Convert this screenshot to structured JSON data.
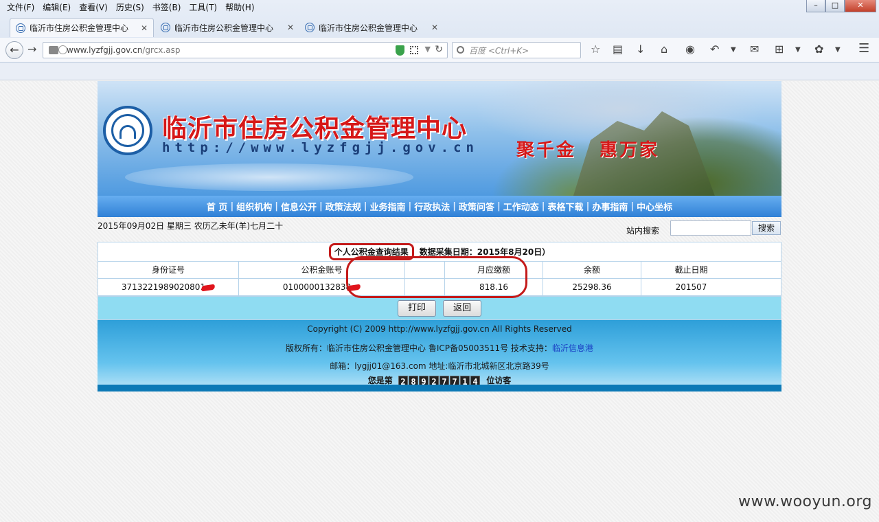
{
  "browser": {
    "menu": [
      "文件(F)",
      "编辑(E)",
      "查看(V)",
      "历史(S)",
      "书签(B)",
      "工具(T)",
      "帮助(H)"
    ],
    "tabs": [
      {
        "label": "临沂市住房公积金管理中心",
        "active": true
      },
      {
        "label": "临沂市住房公积金管理中心",
        "active": false
      },
      {
        "label": "临沂市住房公积金管理中心",
        "active": false
      }
    ],
    "url_host": "www.lyzfgjj.gov.cn",
    "url_path": "/grcx.asp",
    "search_placeholder": "百度 <Ctrl+K>"
  },
  "site": {
    "title": "临沂市住房公积金管理中心",
    "url": "http://www.lyzfgjj.gov.cn",
    "slogan": "聚千金 惠万家",
    "nav": [
      "首 页",
      "组织机构",
      "信息公开",
      "政策法规",
      "业务指南",
      "行政执法",
      "政策问答",
      "工作动态",
      "表格下载",
      "办事指南",
      "中心坐标"
    ],
    "date": "2015年09月02日 星期三 农历乙未年(羊)七月二十",
    "search_label": "站内搜索",
    "search_button": "搜索"
  },
  "result": {
    "title": "个人公积金查询结果",
    "subtitle": "数据采集日期：2015年8月20日）",
    "headers": [
      "身份证号",
      "公积金账号",
      "",
      "月应缴额",
      "余额",
      "截止日期"
    ],
    "row": {
      "id": "371322198902080",
      "id_tail": "1",
      "account": "010000013283",
      "account_tail": "8",
      "blank": "",
      "monthly": "818.16",
      "balance": "25298.36",
      "end_date": "201507"
    },
    "print_button": "打印",
    "back_button": "返回"
  },
  "footer": {
    "copyright": "Copyright (C) 2009 http://www.lyzfgjj.gov.cn All Rights Reserved",
    "owner_prefix": "版权所有：临沂市住房公积金管理中心   鲁ICP备05003511号 技术支持：",
    "owner_link": "临沂信息港",
    "contact": "邮箱：lygjj01@163.com 地址:临沂市北城新区北京路39号",
    "visitor_prefix": "您是第",
    "visitor_digits": [
      "2",
      "8",
      "9",
      "2",
      "7",
      "7",
      "1",
      "4"
    ],
    "visitor_suffix": "位访客"
  },
  "watermark": "www.wooyun.org"
}
